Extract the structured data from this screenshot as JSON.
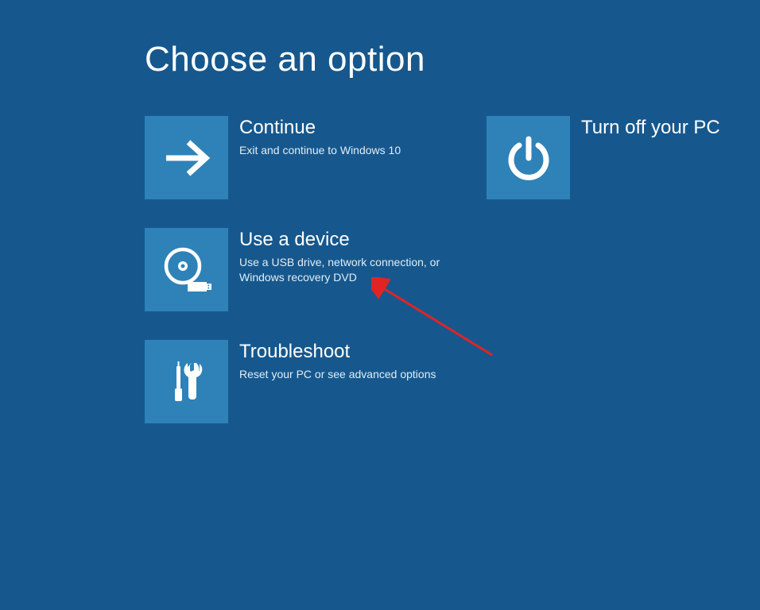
{
  "page": {
    "title": "Choose an option"
  },
  "options": {
    "continue": {
      "title": "Continue",
      "desc": "Exit and continue to Windows 10"
    },
    "use_device": {
      "title": "Use a device",
      "desc": "Use a USB drive, network connection, or Windows recovery DVD"
    },
    "troubleshoot": {
      "title": "Troubleshoot",
      "desc": "Reset your PC or see advanced options"
    },
    "turn_off": {
      "title": "Turn off your PC"
    }
  },
  "colors": {
    "background": "#16588e",
    "tile": "#2e82b8",
    "text": "#ffffff",
    "annotation": "#e02424"
  }
}
